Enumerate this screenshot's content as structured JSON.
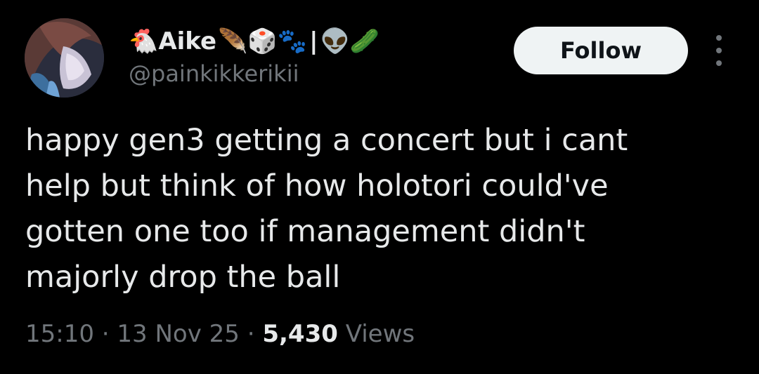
{
  "author": {
    "display_name": "Aike",
    "emoji_before_name": "🐔",
    "emoji_after_name": "🪶🎲🐾",
    "pipe": "|",
    "emoji_after_pipe": "👽🥒",
    "handle": "@painkikkerikii",
    "avatar_icon": "anime-character-avatar"
  },
  "actions": {
    "follow_label": "Follow",
    "more_icon": "vertical-ellipsis-icon"
  },
  "tweet": {
    "lines": [
      "happy gen3 getting a concert but i cant",
      "help but think of how holotori could've",
      "gotten one too if management didn't",
      "majorly drop the ball"
    ]
  },
  "meta": {
    "time": "15:10",
    "separator": "·",
    "date": "13 Nov 25",
    "views_count": "5,430",
    "views_label": "Views"
  },
  "colors": {
    "background": "#000000",
    "primary_text": "#e7e9ea",
    "secondary_text": "#71767b",
    "follow_bg": "#eff3f4",
    "follow_text": "#0f1419"
  }
}
